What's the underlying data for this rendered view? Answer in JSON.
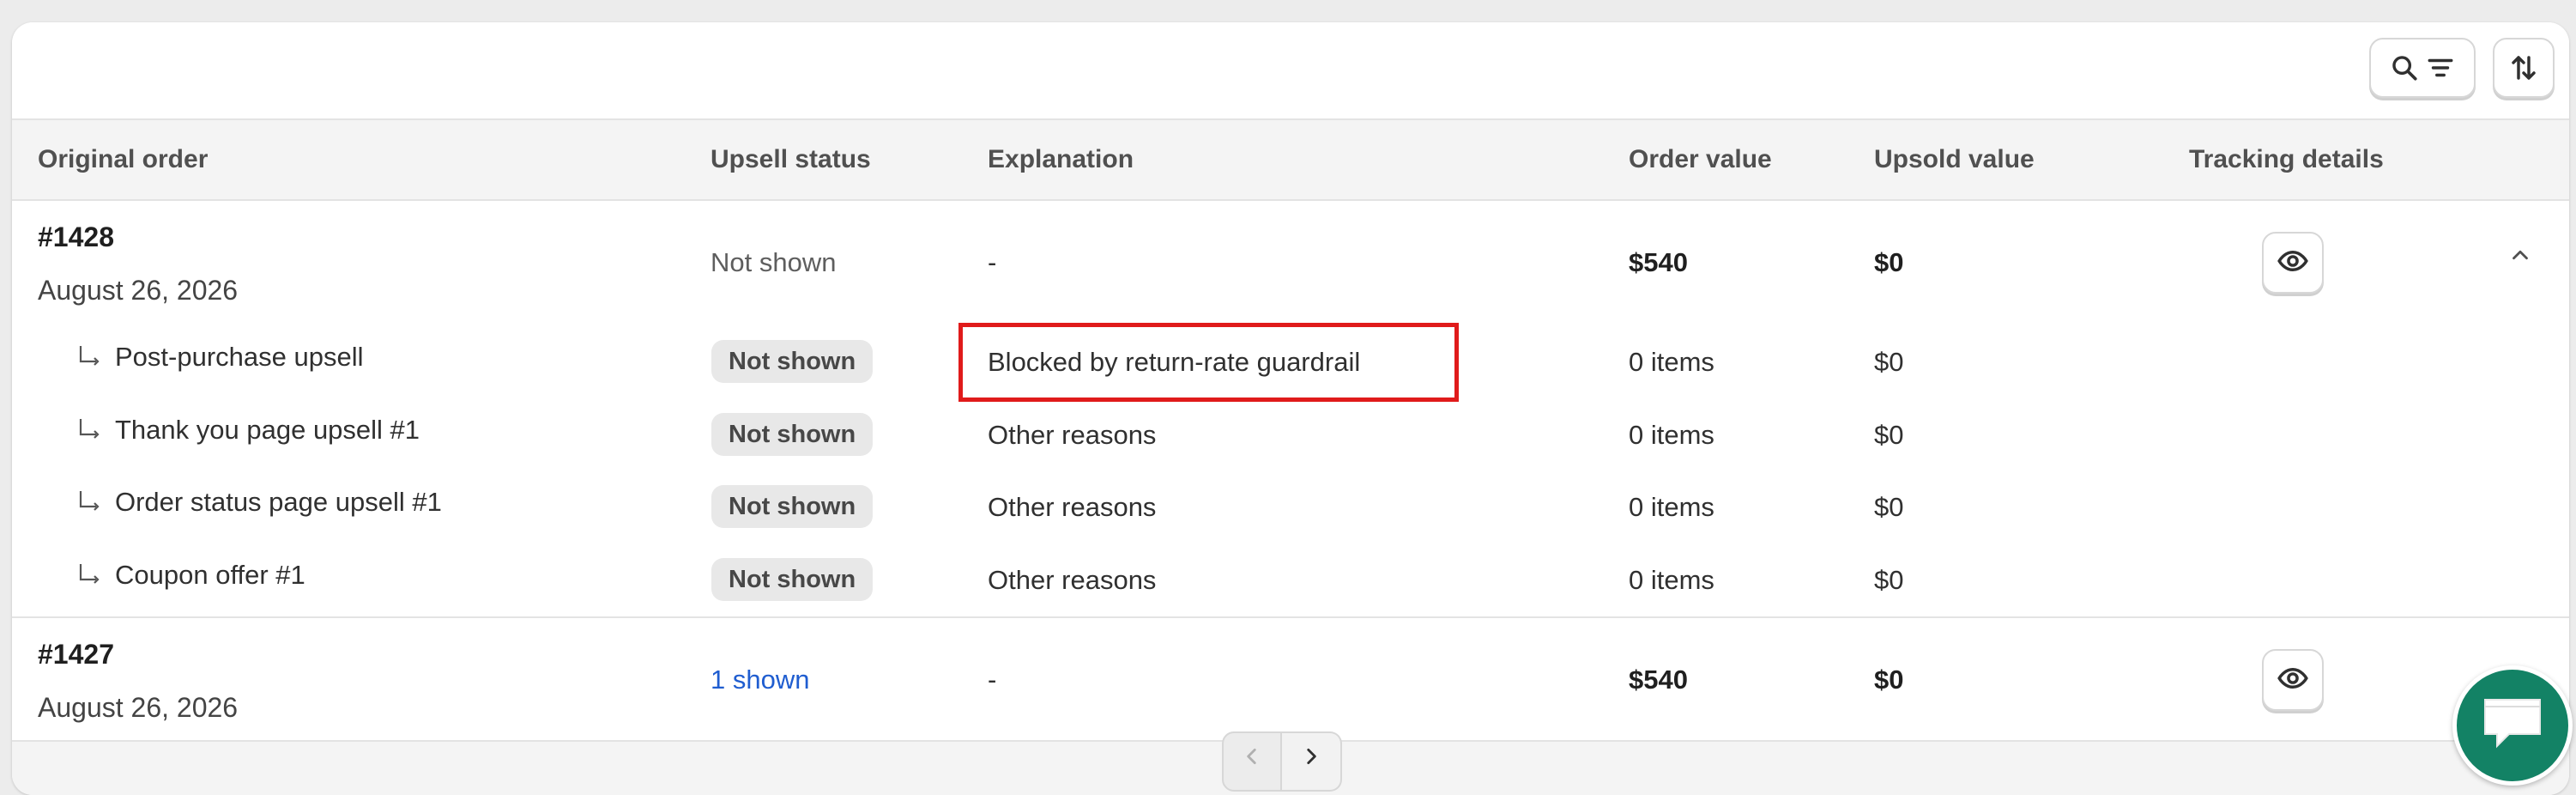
{
  "table": {
    "columns": {
      "original_order": "Original order",
      "upsell_status": "Upsell status",
      "explanation": "Explanation",
      "order_value": "Order value",
      "upsold_value": "Upsold value",
      "tracking_details": "Tracking details"
    },
    "orders": [
      {
        "id": "#1428",
        "date": "August 26, 2026",
        "upsell_status": "Not shown",
        "explanation": "-",
        "order_value": "$540",
        "upsold_value": "$0",
        "expanded": true,
        "sub_rows": [
          {
            "label": "Post-purchase upsell",
            "status": "Not shown",
            "explanation": "Blocked by return-rate guardrail",
            "order_value": "0 items",
            "upsold_value": "$0",
            "highlighted": true
          },
          {
            "label": "Thank you page upsell #1",
            "status": "Not shown",
            "explanation": "Other reasons",
            "order_value": "0 items",
            "upsold_value": "$0"
          },
          {
            "label": "Order status page upsell #1",
            "status": "Not shown",
            "explanation": "Other reasons",
            "order_value": "0 items",
            "upsold_value": "$0"
          },
          {
            "label": "Coupon offer #1",
            "status": "Not shown",
            "explanation": "Other reasons",
            "order_value": "0 items",
            "upsold_value": "$0"
          }
        ]
      },
      {
        "id": "#1427",
        "date": "August 26, 2026",
        "upsell_status": "1 shown",
        "explanation": "-",
        "order_value": "$540",
        "upsold_value": "$0"
      }
    ]
  },
  "icons": {
    "search": "search-icon",
    "filter": "filter-icon",
    "sort": "sort-icon",
    "eye": "eye-icon",
    "collapse": "chevron-up-icon",
    "prev": "chevron-left-icon",
    "next": "chevron-right-icon",
    "chat": "chat-icon"
  },
  "colors": {
    "highlight": "#e01b1b",
    "link": "#1f5dd0",
    "chat": "#138265"
  }
}
